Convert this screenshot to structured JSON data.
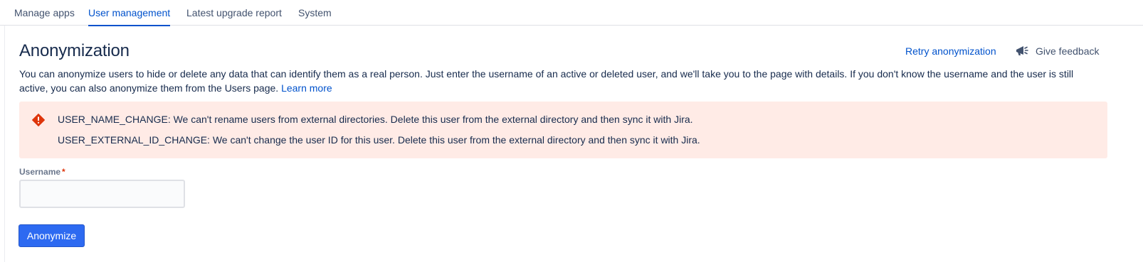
{
  "tabs": [
    {
      "label": "Manage apps",
      "active": false
    },
    {
      "label": "User management",
      "active": true
    },
    {
      "label": "Latest upgrade report",
      "active": false
    },
    {
      "label": "System",
      "active": false
    }
  ],
  "header": {
    "title": "Anonymization",
    "retry_label": "Retry anonymization",
    "feedback_label": "Give feedback",
    "feedback_icon": "megaphone-icon"
  },
  "description": {
    "text": "You can anonymize users to hide or delete any data that can identify them as a real person. Just enter the username of an active or deleted user, and we'll take you to the page with details. If you don't know the username and the user is still active, you can also anonymize them from the Users page.",
    "link_label": "Learn more"
  },
  "error_panel": {
    "icon": "error-icon",
    "color": "#de350b",
    "background": "#ffebe6",
    "messages": [
      "USER_NAME_CHANGE: We can't rename users from external directories. Delete this user from the external directory and then sync it with Jira.",
      "USER_EXTERNAL_ID_CHANGE: We can't change the user ID for this user. Delete this user from the external directory and then sync it with Jira."
    ]
  },
  "form": {
    "username_label": "Username",
    "required_marker": "*",
    "username_value": "",
    "submit_label": "Anonymize"
  },
  "colors": {
    "accent": "#0052cc",
    "primary_button": "#2d6af1"
  }
}
